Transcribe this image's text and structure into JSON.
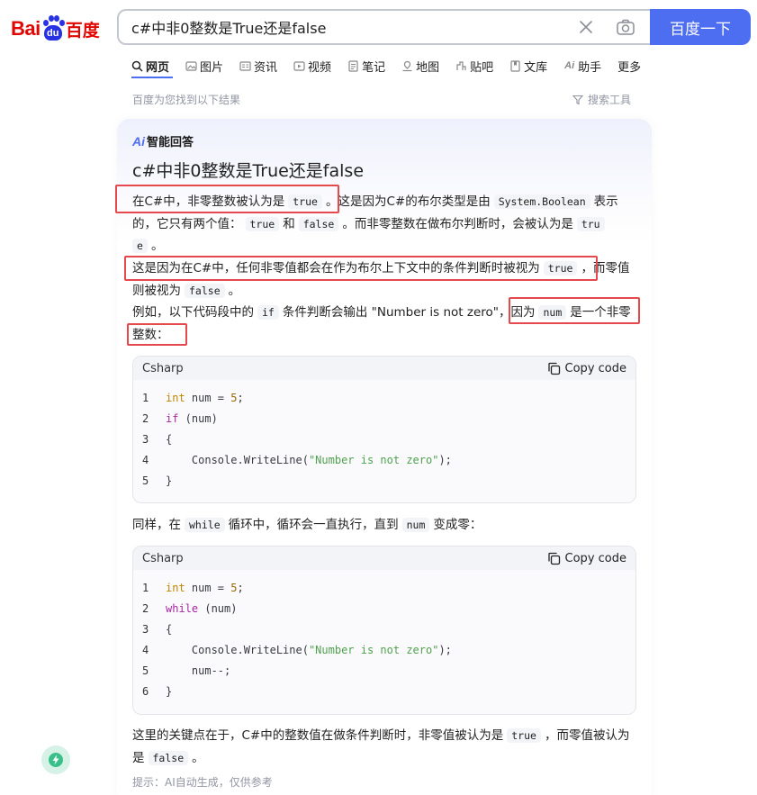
{
  "logo": {
    "text_en": "Bai",
    "paw_text": "du",
    "text_cn": "百度"
  },
  "search": {
    "query": "c#中非0整数是True还是false",
    "button_label": "百度一下"
  },
  "tabs": [
    {
      "label": "网页",
      "icon": "search-icon"
    },
    {
      "label": "图片",
      "icon": "image-icon"
    },
    {
      "label": "资讯",
      "icon": "news-icon"
    },
    {
      "label": "视频",
      "icon": "video-icon"
    },
    {
      "label": "笔记",
      "icon": "note-icon"
    },
    {
      "label": "地图",
      "icon": "map-icon"
    },
    {
      "label": "贴吧",
      "icon": "tieba-icon"
    },
    {
      "label": "文库",
      "icon": "library-icon"
    },
    {
      "label": "助手",
      "icon": "ai-icon"
    },
    {
      "label": "更多"
    }
  ],
  "result_count": "百度为您找到以下结果",
  "search_tools": "搜索工具",
  "answer": {
    "badge": "智能回答",
    "title": "c#中非0整数是True还是false",
    "p1": {
      "a": "在C#中，非零整数被认为是",
      "c1": "true",
      "b": "。这是因为C#的布尔类型是由",
      "c2": "System.Boolean",
      "c": "表示的，它只有两个值：",
      "c3": "true",
      "d": "和",
      "c4": "false",
      "e": "。而非零整数在做布尔判断时，会被认为是",
      "c5a": "tru",
      "c5b": "e",
      "f": "。"
    },
    "p2": {
      "a": "这是因为在C#中，任何非零值都会在作为布尔上下文中的条件判断时被视为",
      "c1": "true",
      "b": "，而零值则被视为",
      "c2": "false",
      "c": "。"
    },
    "p3": {
      "a": "例如，以下代码段中的",
      "c1": "if",
      "b": "条件判断会输出 \"Number is not zero\"，因为",
      "c2": "num",
      "c": "是一个非零整数："
    },
    "code1": {
      "lang": "Csharp",
      "copy": "Copy code",
      "lines": [
        {
          "n": "1",
          "kw": "int",
          "rest": " num = ",
          "num": "5",
          "end": ";"
        },
        {
          "n": "2",
          "kw": "if",
          "rest": " (num)"
        },
        {
          "n": "3",
          "rest": "{"
        },
        {
          "n": "4",
          "rest": "    Console.WriteLine(",
          "str": "\"Number is not zero\"",
          "end": ");"
        },
        {
          "n": "5",
          "rest": "}"
        }
      ]
    },
    "p4": {
      "a": "同样，在",
      "c1": "while",
      "b": "循环中，循环会一直执行，直到",
      "c2": "num",
      "c": "变成零："
    },
    "code2": {
      "lang": "Csharp",
      "copy": "Copy code",
      "lines": [
        {
          "n": "1",
          "kw": "int",
          "rest": " num = ",
          "num": "5",
          "end": ";"
        },
        {
          "n": "2",
          "kw": "while",
          "rest": " (num)"
        },
        {
          "n": "3",
          "rest": "{"
        },
        {
          "n": "4",
          "rest": "    Console.WriteLine(",
          "str": "\"Number is not zero\"",
          "end": ");"
        },
        {
          "n": "5",
          "rest": "    num--;"
        },
        {
          "n": "6",
          "rest": "}"
        }
      ]
    },
    "p5": {
      "a": "这里的关键点在于，C#中的整数值在做条件判断时，非零值被认为是",
      "c1": "true",
      "b": "，而零值被认为是",
      "c2": "false",
      "c": "。"
    },
    "footnote": "提示：AI自动生成，仅供参考"
  },
  "colors": {
    "brand_blue": "#4e6ef2",
    "highlight_red": "#e5484d",
    "logo_red": "#e10602"
  }
}
